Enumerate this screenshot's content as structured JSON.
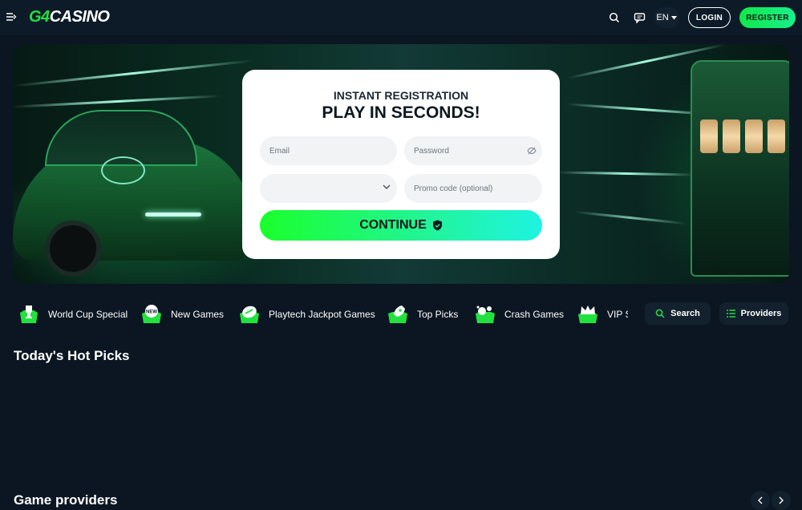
{
  "header": {
    "logo_primary": "G4",
    "logo_secondary": "CASINO",
    "language": "EN",
    "login_label": "LOGIN",
    "register_label": "REGISTER"
  },
  "registration": {
    "subtitle": "INSTANT REGISTRATION",
    "title": "PLAY IN SECONDS!",
    "email_placeholder": "Email",
    "password_placeholder": "Password",
    "currency_value": "",
    "promo_placeholder": "Promo code (optional)",
    "continue_label": "CONTINUE"
  },
  "categories": [
    {
      "label": "World Cup Special",
      "icon": "trophy-icon"
    },
    {
      "label": "New Games",
      "icon": "new-badge-icon"
    },
    {
      "label": "Playtech Jackpot Games",
      "icon": "jackpot-icon"
    },
    {
      "label": "Top Picks",
      "icon": "rocket-icon"
    },
    {
      "label": "Crash Games",
      "icon": "crash-icon"
    },
    {
      "label": "VIP S",
      "icon": "crown-icon"
    }
  ],
  "filters": {
    "search_label": "Search",
    "providers_label": "Providers"
  },
  "sections": {
    "hot_picks": "Today's Hot Picks",
    "providers": "Game providers"
  },
  "colors": {
    "accent": "#22e13f",
    "background": "#0b1622",
    "surface": "#13212f"
  }
}
